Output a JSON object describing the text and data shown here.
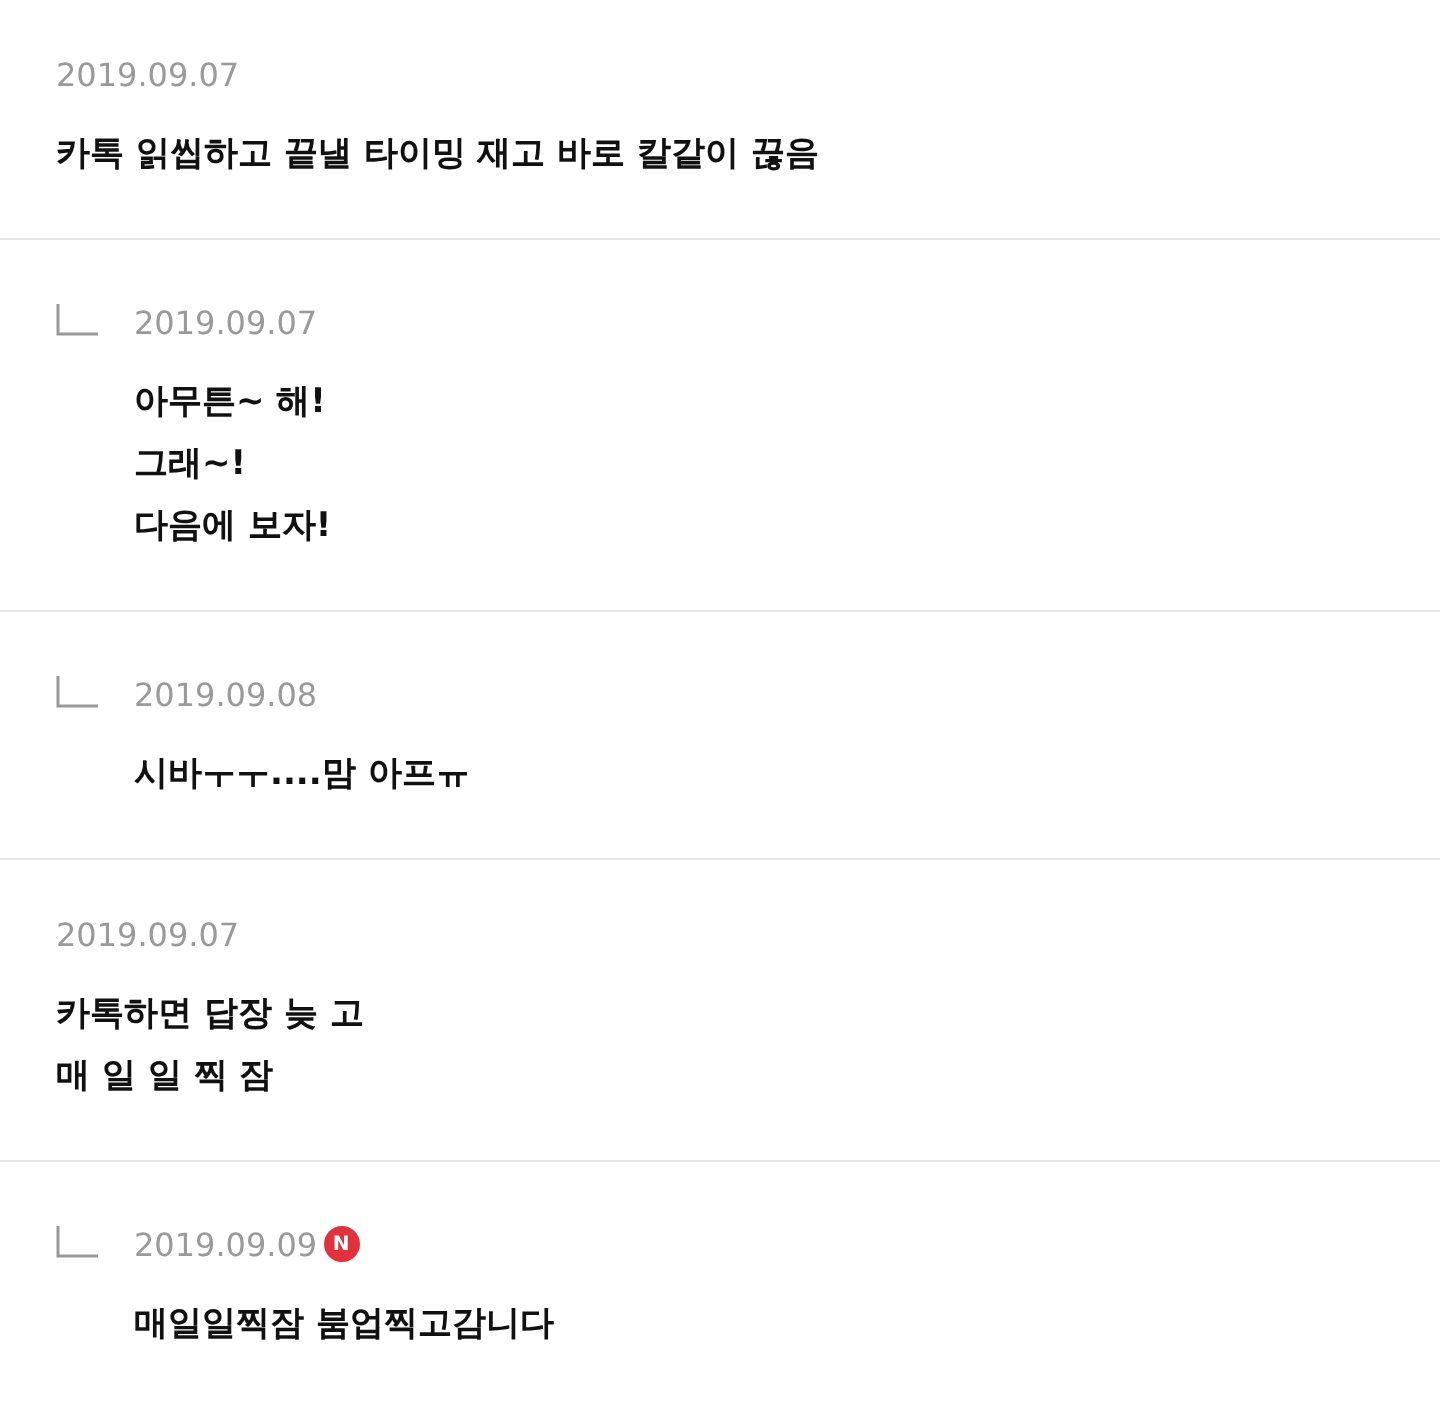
{
  "comments": [
    {
      "reply": false,
      "date": "2019.09.07",
      "lines": [
        "카톡 읽씹하고 끝낼 타이밍 재고 바로 칼같이 끊음"
      ]
    },
    {
      "reply": true,
      "date": "2019.09.07",
      "lines": [
        "아무튼~ 해!",
        "그래~!",
        "다음에 보자!"
      ]
    },
    {
      "reply": true,
      "date": "2019.09.08",
      "lines": [
        "시바ㅜㅜ....맘 아프ㅠ"
      ]
    },
    {
      "reply": false,
      "date": "2019.09.07",
      "lines": [
        "카톡하면 답장 늦 고",
        "매 일 일 찍 잠"
      ]
    },
    {
      "reply": true,
      "date": "2019.09.09",
      "badge": "N",
      "lines": [
        "매일일찍잠 붐업찍고감니다"
      ]
    }
  ]
}
